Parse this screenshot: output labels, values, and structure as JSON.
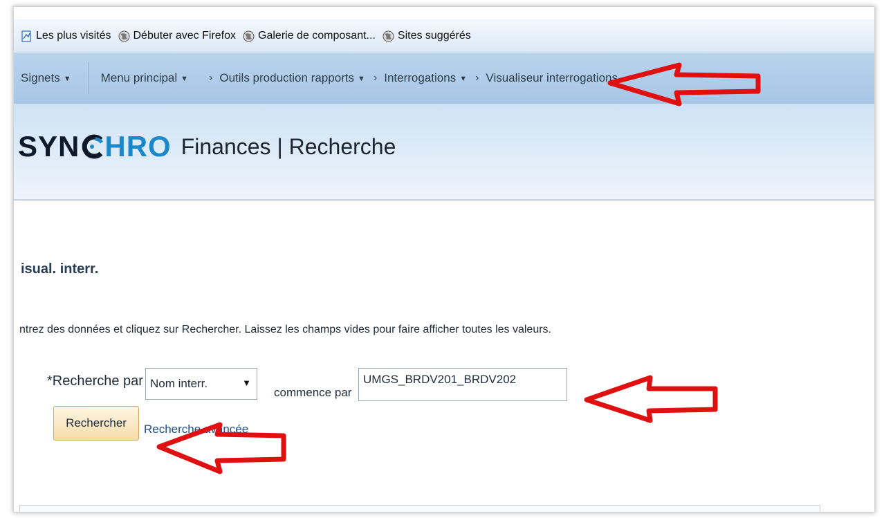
{
  "bookmarks": [
    {
      "label": "Les plus visités",
      "icon": "page-icon"
    },
    {
      "label": "Débuter avec Firefox",
      "icon": "globe-icon"
    },
    {
      "label": "Galerie de composant...",
      "icon": "globe-icon"
    },
    {
      "label": "Sites suggérés",
      "icon": "globe-icon"
    }
  ],
  "nav": {
    "bookmarks_menu": "Signets",
    "main_menu": "Menu principal",
    "crumbs": [
      "Outils production rapports",
      "Interrogations",
      "Visualiseur interrogations"
    ]
  },
  "header": {
    "logo_part1": "SYN",
    "logo_part2": "HRO",
    "title": "Finances | Recherche"
  },
  "page": {
    "title": "isual. interr.",
    "instructions": "ntrez des données et cliquez sur Rechercher. Laissez les champs vides pour faire afficher toutes les valeurs."
  },
  "search": {
    "label": "*Recherche par",
    "field_selected": "Nom interr.",
    "operator": "commence par",
    "value": "UMGS_BRDV201_BRDV202",
    "button": "Rechercher",
    "advanced_link": "Recherche avancée"
  },
  "colors": {
    "annotation_arrow": "#e01010",
    "logo_blue": "#1b88c9",
    "nav_bar": "#b9d3ec"
  }
}
